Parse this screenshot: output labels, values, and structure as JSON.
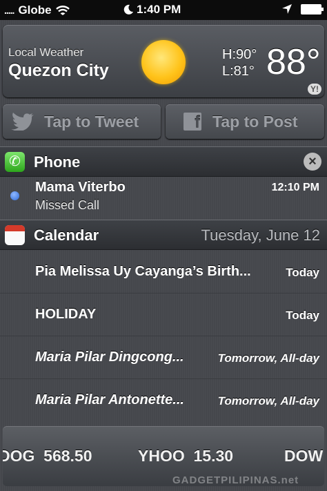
{
  "status_bar": {
    "signal": ".....",
    "carrier": "Globe",
    "time": "1:40 PM"
  },
  "weather": {
    "label": "Local Weather",
    "city": "Quezon City",
    "high": "H:90°",
    "low": "L:81°",
    "temp": "88°",
    "provider_badge": "Y!"
  },
  "share": {
    "tweet_label": "Tap to Tweet",
    "post_label": "Tap to Post"
  },
  "phone": {
    "title": "Phone",
    "item": {
      "name": "Mama Viterbo",
      "subtitle": "Missed Call",
      "time": "12:10 PM"
    }
  },
  "calendar": {
    "title": "Calendar",
    "date": "Tuesday, June 12",
    "events": [
      {
        "title": "Pia Melissa Uy Cayanga’s Birth...",
        "when": "Today"
      },
      {
        "title": "HOLIDAY",
        "when": "Today"
      },
      {
        "title": "Maria Pilar Dingcong...",
        "when": "Tomorrow, All-day"
      },
      {
        "title": "Maria Pilar Antonette...",
        "when": "Tomorrow, All-day"
      }
    ]
  },
  "stocks": [
    {
      "symbol": "DOG",
      "value": "568.50"
    },
    {
      "symbol": "YHOO",
      "value": "15.30"
    },
    {
      "symbol": "DOW",
      "value": ""
    }
  ],
  "watermark": "GADGETPILIPINAS.net",
  "colors": {
    "phone_icon": "#2da61c",
    "missed_dot": "#2f6ad8",
    "sun": "#ffc31a"
  }
}
